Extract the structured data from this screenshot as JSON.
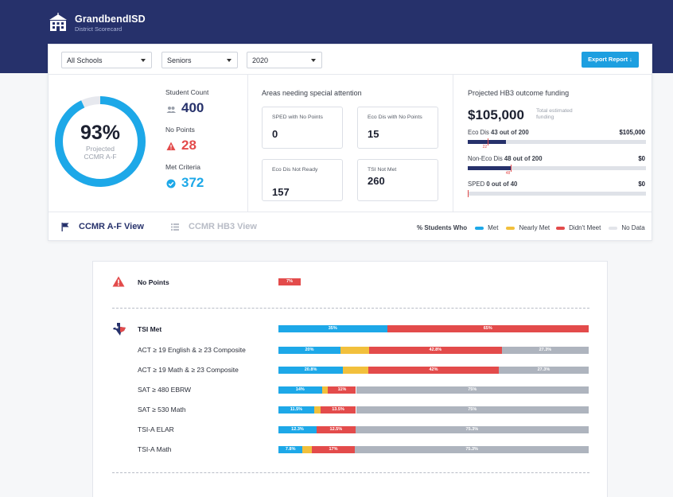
{
  "app": {
    "name": "GrandbendISD",
    "subtitle": "District Scorecard"
  },
  "filters": {
    "school": "All Schools",
    "grade": "Seniors",
    "year": "2020",
    "export_label": "Export Report ↓"
  },
  "summary": {
    "percent": "93%",
    "percent_label_1": "Projected",
    "percent_label_2": "CCMR A-F",
    "donut_fraction": 0.93,
    "student_count_label": "Student Count",
    "student_count": "400",
    "no_points_label": "No Points",
    "no_points": "28",
    "met_criteria_label": "Met Criteria",
    "met_criteria": "372"
  },
  "attention": {
    "title": "Areas needing special attention",
    "cards": [
      {
        "label": "SPED with No Points",
        "value": "0"
      },
      {
        "label": "Eco Dis with No Points",
        "value": "15"
      },
      {
        "label": "Eco Dis Not Ready",
        "value": "157"
      },
      {
        "label": "TSI Not Met",
        "value": "260"
      }
    ]
  },
  "funding": {
    "title": "Projected HB3 outcome funding",
    "total": "$105,000",
    "total_note": "Total estimated funding",
    "rows": [
      {
        "label_bold": "Eco Dis",
        "label": " 43 out of 200",
        "amount": "$105,000",
        "fill": 0.215,
        "marker": 0.11,
        "tag": "22"
      },
      {
        "label_bold": "Non-Eco Dis",
        "label": " 48 out of 200",
        "amount": "$0",
        "fill": 0.24,
        "marker": 0.24,
        "tag": "48"
      },
      {
        "label_bold": "SPED",
        "label": " 0 out of 40",
        "amount": "$0",
        "fill": 0,
        "marker": 0.0,
        "tag": ""
      }
    ]
  },
  "views": {
    "active": "CCMR A-F View",
    "inactive": "CCMR HB3 View"
  },
  "legend": {
    "title": "% Students Who",
    "met": "Met",
    "nearly": "Nearly Met",
    "didnt": "Didn't Meet",
    "nodata": "No Data"
  },
  "colors": {
    "met": "#1da8e8",
    "nearly": "#f2c03c",
    "didnt": "#e34b4b",
    "nodata": "#aeb4be",
    "navy": "#26316b"
  },
  "breakdown": {
    "no_points": {
      "title": "No Points",
      "pct": "7%",
      "value": 7
    },
    "tsi": {
      "title": "TSI Met",
      "summary": {
        "met": 35,
        "didnt": 65,
        "met_label": "35%",
        "didnt_label": "65%"
      },
      "rows": [
        {
          "label": "ACT ≥ 19 English & ≥ 23 Composite",
          "met": 20,
          "nearly": 9.2,
          "didnt": 42.8,
          "nodata": 28,
          "labels": [
            "20%",
            "",
            "42.8%",
            "27.3%"
          ]
        },
        {
          "label": "ACT ≥ 19 Math & ≥ 23 Composite",
          "met": 20.8,
          "nearly": 8.2,
          "didnt": 42,
          "nodata": 29,
          "labels": [
            "20.8%",
            "",
            "42%",
            "27.3%"
          ]
        },
        {
          "label": "SAT ≥ 480 EBRW",
          "met": 14,
          "nearly": 2,
          "didnt": 9,
          "nodata": 75,
          "labels": [
            "14%",
            "",
            "11%",
            "75%"
          ]
        },
        {
          "label": "SAT ≥ 530 Math",
          "met": 11.5,
          "nearly": 2,
          "didnt": 11.5,
          "nodata": 75,
          "labels": [
            "11.5%",
            "",
            "13.5%",
            "75%"
          ]
        },
        {
          "label": "TSI-A ELAR",
          "met": 12.3,
          "nearly": 0,
          "didnt": 12.5,
          "nodata": 75.2,
          "labels": [
            "12.3%",
            "",
            "12.5%",
            "75.3%"
          ]
        },
        {
          "label": "TSI-A Math",
          "met": 7.8,
          "nearly": 2.9,
          "didnt": 14,
          "nodata": 75.3,
          "labels": [
            "7.8%",
            "",
            "17%",
            "75.3%"
          ]
        }
      ]
    }
  }
}
